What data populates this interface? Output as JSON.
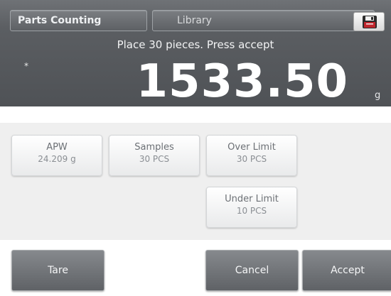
{
  "header": {
    "app_tab_label": "Parts Counting",
    "library_tab_label": "Library",
    "save_icon": "floppy-disk-icon"
  },
  "status": {
    "prompt": "Place 30 pieces.  Press accept",
    "stable_indicator": "*"
  },
  "readout": {
    "value": "1533.50",
    "unit": "g",
    "secondary": "1533.50 g"
  },
  "params": {
    "apw": {
      "label": "APW",
      "value": "24.209 g"
    },
    "samples": {
      "label": "Samples",
      "value": "30 PCS"
    },
    "over_limit": {
      "label": "Over Limit",
      "value": "30 PCS"
    },
    "under_limit": {
      "label": "Under Limit",
      "value": "10 PCS"
    }
  },
  "buttons": {
    "tare": "Tare",
    "cancel": "Cancel",
    "accept": "Accept"
  },
  "colors": {
    "header_bg": "#5b5e62",
    "button_bg": "#6f7276",
    "panel_bg": "#efefef",
    "save_icon_red": "#c0262d"
  }
}
